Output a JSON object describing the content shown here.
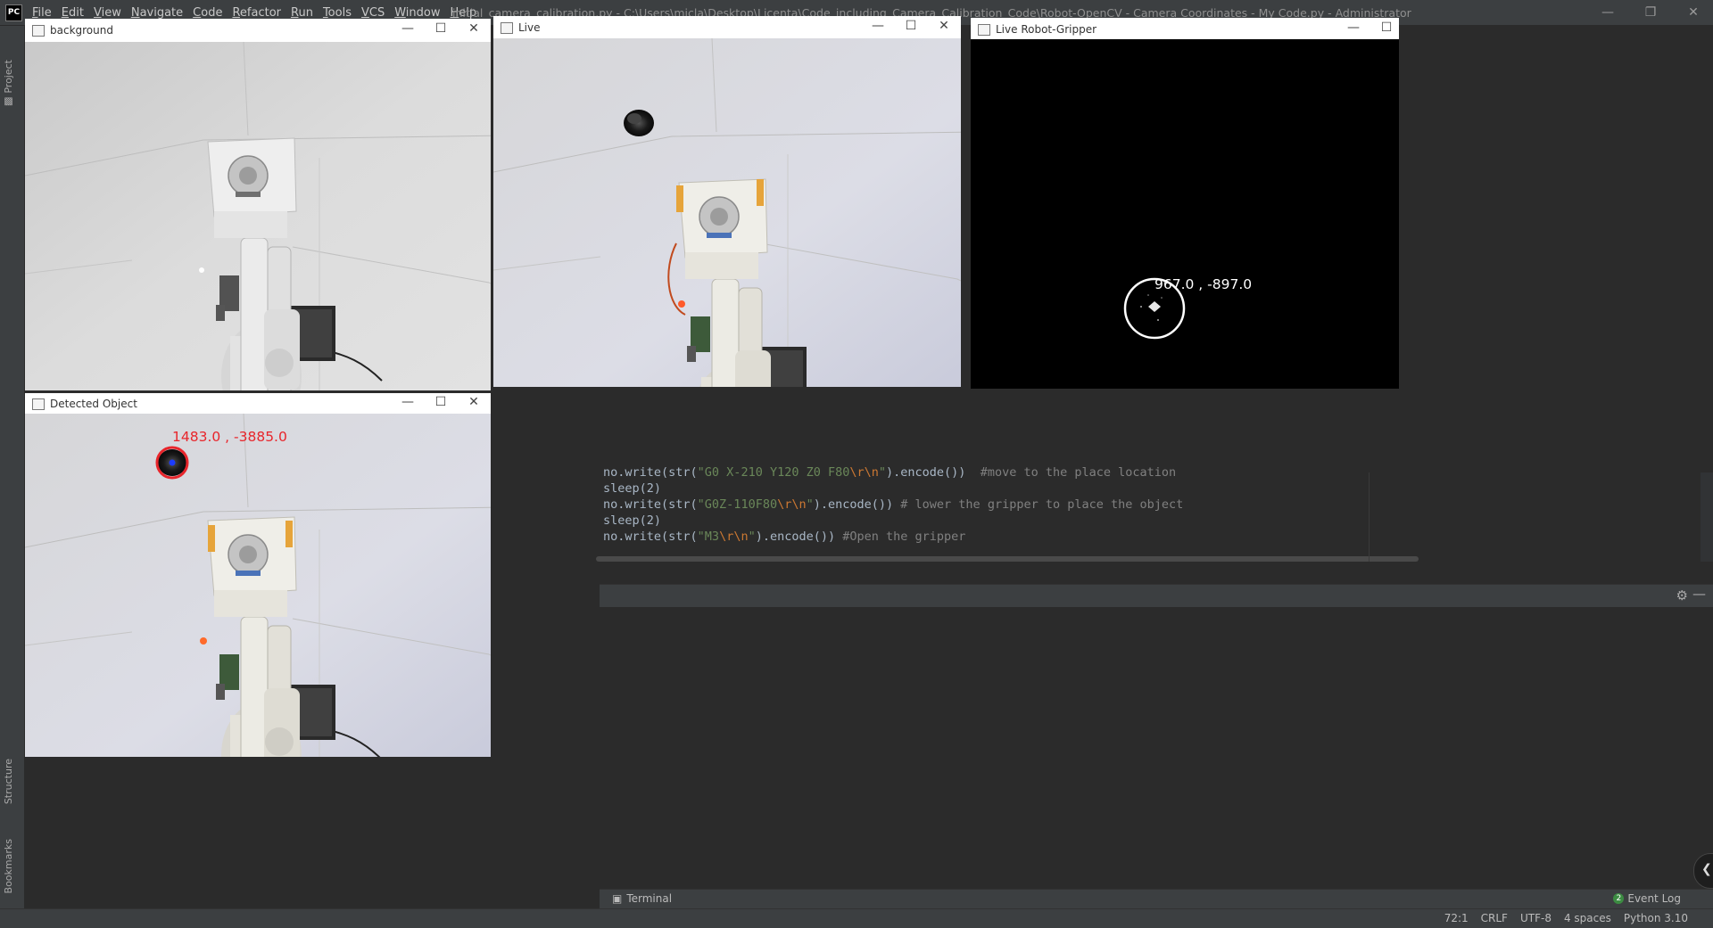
{
  "ide": {
    "logo": "PC",
    "menu": [
      "File",
      "Edit",
      "View",
      "Navigate",
      "Code",
      "Refactor",
      "Run",
      "Tools",
      "VCS",
      "Window",
      "Help"
    ],
    "window_title": "initial_camera_calibration.py - C:\\Users\\micla\\Desktop\\Licenta\\Code_including_Camera_Calibration_Code\\Robot-OpenCV - Camera Coordinates - My Code.py - Administrator",
    "left_tabs": {
      "project": "Project",
      "structure": "Structure",
      "bookmarks": "Bookmarks"
    },
    "bottom_toolbar": {
      "terminal": "Terminal",
      "event_log_count": "2",
      "event_log": "Event Log"
    },
    "status_bar": {
      "position": "72:1",
      "line_sep": "CRLF",
      "encoding": "UTF-8",
      "indent": "4 spaces",
      "interpreter": "Python 3.10"
    },
    "code_lines": [
      {
        "pre": "no.write(str(",
        "str": "\"G0 X-210 Y120 Z0 F80",
        "esc": "\\r\\n",
        "str2": "\"",
        "post": ").encode())  ",
        "cmt": "#move to the place location"
      },
      {
        "pre": "sleep(2)",
        "str": "",
        "esc": "",
        "str2": "",
        "post": "",
        "cmt": ""
      },
      {
        "pre": "no.write(str(",
        "str": "\"G0Z-110F80",
        "esc": "\\r\\n",
        "str2": "\"",
        "post": ").encode()) ",
        "cmt": "# lower the gripper to place the object"
      },
      {
        "pre": "sleep(2)",
        "str": "",
        "esc": "",
        "str2": "",
        "post": "",
        "cmt": ""
      },
      {
        "pre": "no.write(str(",
        "str": "\"M3",
        "esc": "\\r\\n",
        "str2": "\"",
        "post": ").encode()) ",
        "cmt": "#Open the gripper"
      }
    ]
  },
  "windows": {
    "background": {
      "title": "background"
    },
    "live": {
      "title": "Live"
    },
    "gripper": {
      "title": "Live Robot-Gripper",
      "coords": "967.0 , -897.0"
    },
    "detected": {
      "title": "Detected Object",
      "coords": "1483.0 , -3885.0"
    }
  },
  "colors": {
    "ide_bg": "#2b2b2b",
    "ide_panel": "#3c3f41",
    "detect_red": "#e8252b",
    "gripper_bg": "#000000"
  }
}
